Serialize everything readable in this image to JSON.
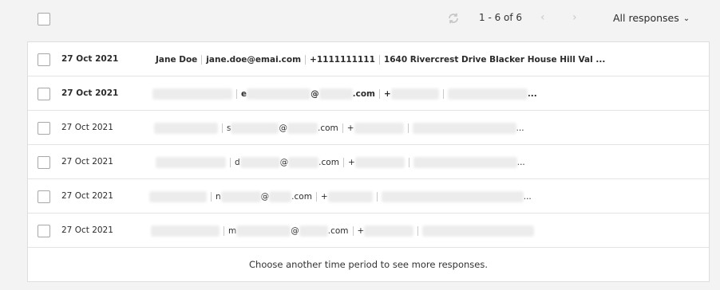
{
  "pagination": {
    "range": "1 - 6 of 6"
  },
  "filter": {
    "label": "All responses"
  },
  "icons": {
    "refresh": "refresh-icon",
    "prev": "chevron-left-icon",
    "next": "chevron-right-icon",
    "dropdown": "chevron-down-icon"
  },
  "rows": [
    {
      "date": "27 Oct 2021",
      "name": "Jane Doe",
      "email": "jane.doe@emai.com",
      "phone": "+1111111111",
      "address": "1640 Rivercrest Drive Blacker House Hill Val ..."
    },
    {
      "date": "27 Oct 2021",
      "email_prefix": "e",
      "email_at": "@",
      "email_suffix": ".com",
      "phone_prefix": "+",
      "ellipsis": "..."
    },
    {
      "date": "27 Oct 2021",
      "email_prefix": "s",
      "email_at": "@",
      "email_suffix": ".com",
      "phone_prefix": "+",
      "ellipsis": "..."
    },
    {
      "date": "27 Oct 2021",
      "email_prefix": "d",
      "email_at": "@",
      "email_suffix": ".com",
      "phone_prefix": "+",
      "ellipsis": "..."
    },
    {
      "date": "27 Oct 2021",
      "email_prefix": "n",
      "email_at": "@",
      "email_suffix": ".com",
      "phone_prefix": "+",
      "ellipsis": "..."
    },
    {
      "date": "27 Oct 2021",
      "email_prefix": "m",
      "email_at": "@",
      "email_suffix": ".com",
      "phone_prefix": "+",
      "ellipsis": ""
    }
  ],
  "footer": {
    "message": "Choose another time period to see more responses."
  }
}
